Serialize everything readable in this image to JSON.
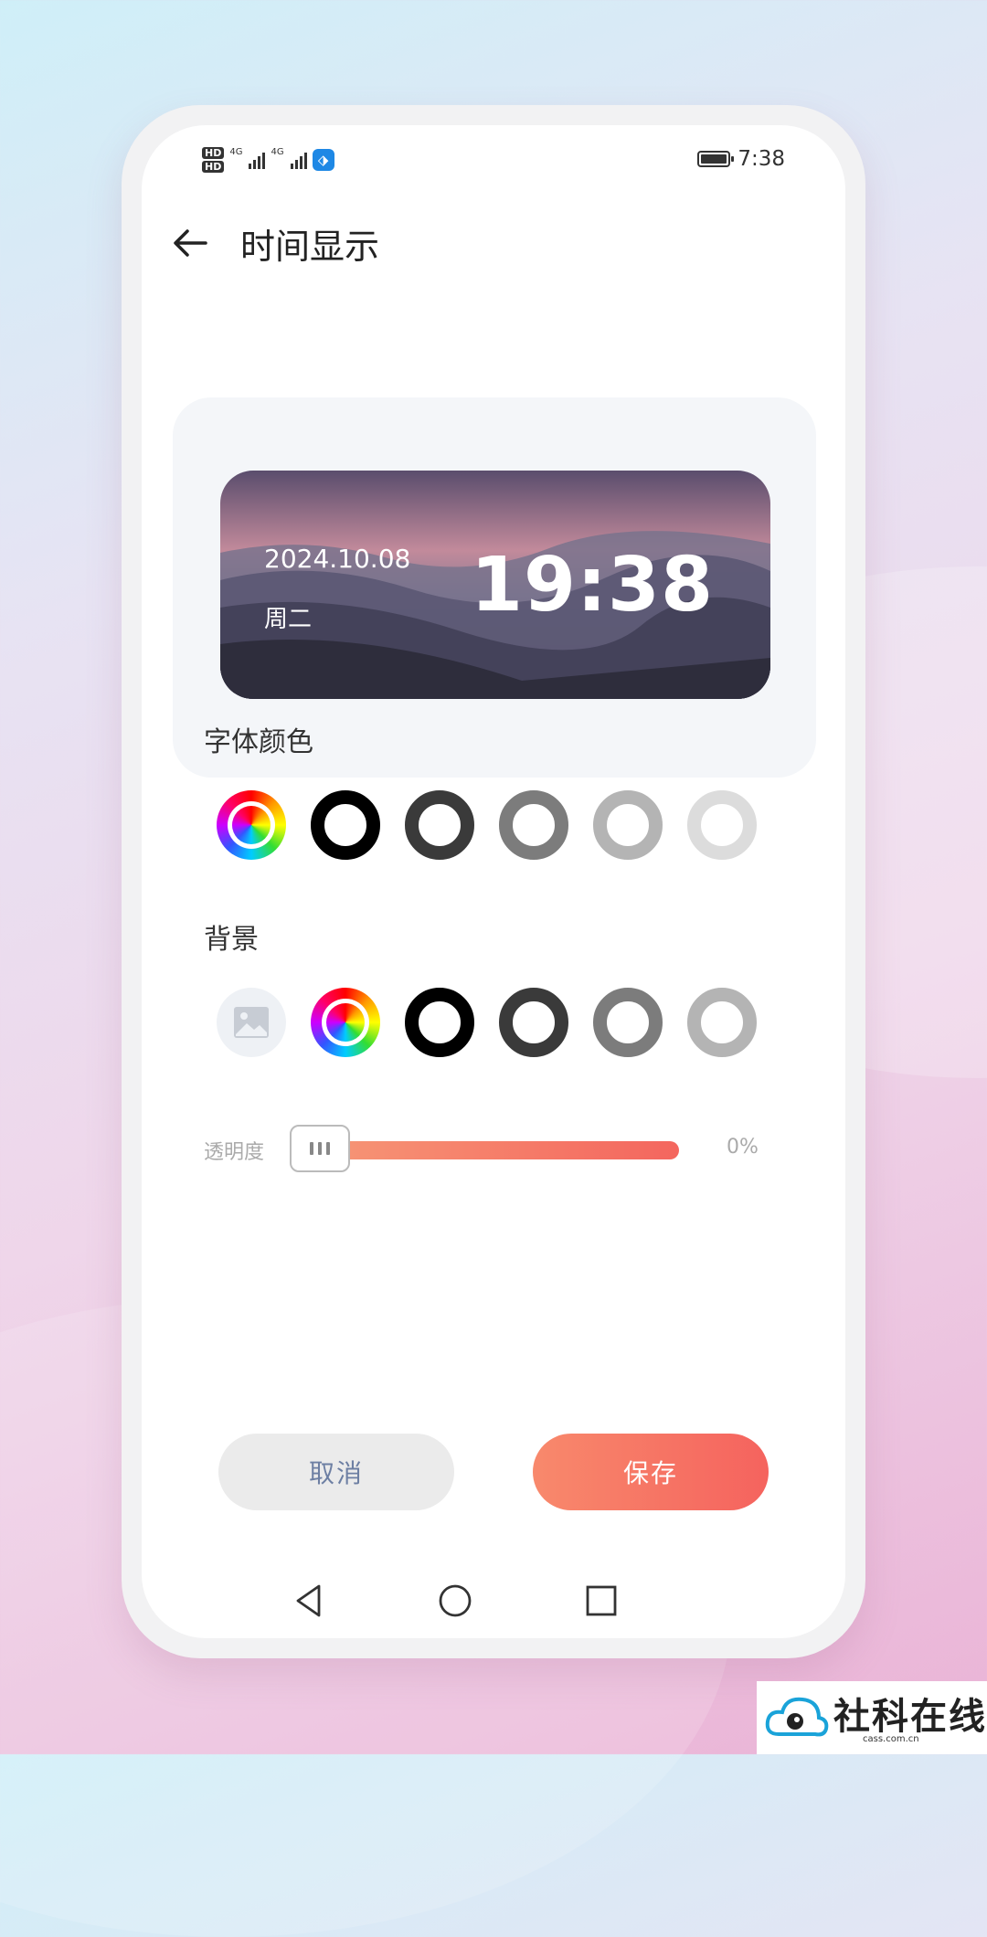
{
  "status_bar": {
    "hd_1": "HD",
    "hd_2": "HD",
    "sig1_label": "4G",
    "sig2_label": "4G",
    "time": "7:38",
    "icons": [
      "hd-icon",
      "signal-icon",
      "app-icon",
      "battery-icon"
    ]
  },
  "header": {
    "title": "时间显示",
    "back_icon": "arrow-left-icon"
  },
  "preview": {
    "date": "2024.10.08",
    "weekday": "周二",
    "time": "19:38"
  },
  "font_color": {
    "label": "字体颜色",
    "swatches": [
      {
        "type": "rainbow",
        "name": "custom-color"
      },
      {
        "type": "ring",
        "color": "#000000"
      },
      {
        "type": "ring",
        "color": "#3a3a3a"
      },
      {
        "type": "ring",
        "color": "#7c7c7c"
      },
      {
        "type": "ring",
        "color": "#b4b4b4"
      },
      {
        "type": "ring",
        "color": "#dcdcdc"
      },
      {
        "type": "ring",
        "color": "#f3edbb"
      }
    ]
  },
  "background": {
    "label": "背景",
    "swatches": [
      {
        "type": "image",
        "name": "image-icon"
      },
      {
        "type": "rainbow",
        "name": "custom-color"
      },
      {
        "type": "ring",
        "color": "#000000"
      },
      {
        "type": "ring",
        "color": "#3a3a3a"
      },
      {
        "type": "ring",
        "color": "#7c7c7c"
      },
      {
        "type": "ring",
        "color": "#b4b4b4"
      },
      {
        "type": "ring",
        "color": "#dcdcdc"
      }
    ]
  },
  "opacity": {
    "label": "透明度",
    "value": "0%",
    "level": 0
  },
  "buttons": {
    "cancel": "取消",
    "save": "保存"
  },
  "colors": {
    "accent_start": "#f8896c",
    "accent_end": "#f5635e",
    "cancel_text": "#6d7fa3"
  },
  "watermark": {
    "text": "社科在线",
    "sub": "cass.com.cn"
  }
}
